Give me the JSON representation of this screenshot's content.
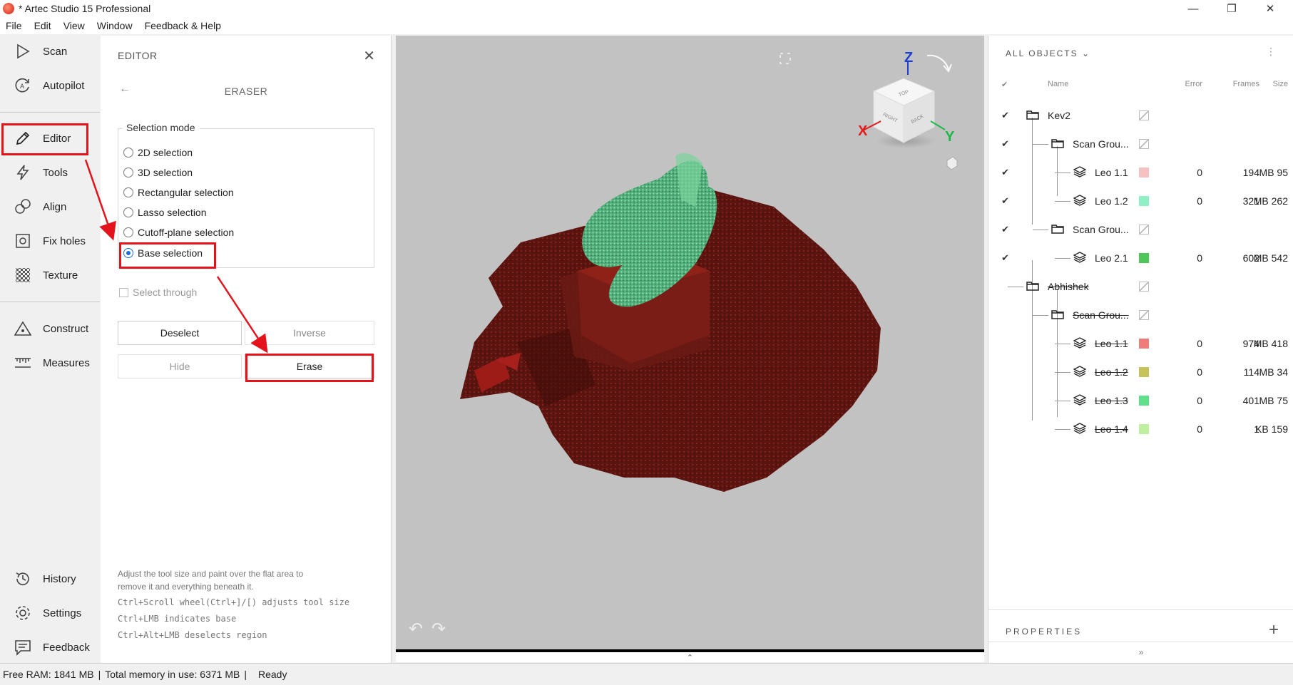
{
  "window": {
    "title": "* Artec Studio 15 Professional",
    "minimize": "—",
    "restore": "❐",
    "close": "✕"
  },
  "menu": [
    "File",
    "Edit",
    "View",
    "Window",
    "Feedback & Help"
  ],
  "nav": {
    "scan": "Scan",
    "autopilot": "Autopilot",
    "editor": "Editor",
    "tools": "Tools",
    "align": "Align",
    "fix_holes": "Fix holes",
    "texture": "Texture",
    "construct": "Construct",
    "measures": "Measures",
    "history": "History",
    "settings": "Settings",
    "feedback": "Feedback"
  },
  "editor": {
    "title": "EDITOR",
    "subtitle": "ERASER",
    "selection_mode_label": "Selection mode",
    "modes": [
      "2D selection",
      "3D selection",
      "Rectangular selection",
      "Lasso selection",
      "Cutoff-plane selection",
      "Base selection"
    ],
    "selected_mode": "Base selection",
    "select_through": "Select through",
    "deselect": "Deselect",
    "inverse": "Inverse",
    "hide": "Hide",
    "erase": "Erase",
    "help": [
      "Adjust the tool size and paint over the flat area to",
      "remove it and everything beneath it.",
      "Ctrl+Scroll wheel(Ctrl+]/[) adjusts tool size",
      "Ctrl+LMB indicates base",
      "Ctrl+Alt+LMB deselects region"
    ]
  },
  "viewport": {
    "axis_x": "X",
    "axis_y": "Y",
    "axis_z": "Z",
    "cube_top": "TOP",
    "cube_right": "RIGHT",
    "cube_back": "BACK",
    "undo": "↶",
    "redo": "↷",
    "expand": "⌃"
  },
  "objects": {
    "header": "ALL OBJECTS",
    "columns": {
      "name": "Name",
      "error": "Error",
      "frames": "Frames",
      "size": "Size"
    },
    "rows": [
      {
        "name": "Kev2",
        "type": "folder",
        "checked": true,
        "error": "",
        "frames": "",
        "size": "",
        "color": "",
        "struck": false
      },
      {
        "name": "Scan Grou...",
        "type": "folder",
        "checked": true,
        "error": "",
        "frames": "",
        "size": "",
        "color": "",
        "struck": false
      },
      {
        "name": "Leo 1.1",
        "type": "scan",
        "checked": true,
        "error": "0",
        "frames": "194",
        "size": "95 MB",
        "color": "#f6c1c1",
        "struck": false
      },
      {
        "name": "Leo 1.2",
        "type": "scan",
        "checked": true,
        "error": "0",
        "frames": "321",
        "size": "262 MB",
        "color": "#8ff0c6",
        "struck": false
      },
      {
        "name": "Scan Grou...",
        "type": "folder",
        "checked": true,
        "error": "",
        "frames": "",
        "size": "",
        "color": "",
        "struck": false
      },
      {
        "name": "Leo 2.1",
        "type": "scan",
        "checked": true,
        "error": "0",
        "frames": "602",
        "size": "542 MB",
        "color": "#4fc65a",
        "struck": false
      },
      {
        "name": "Abhishek",
        "type": "folder",
        "checked": false,
        "error": "",
        "frames": "",
        "size": "",
        "color": "",
        "struck": true
      },
      {
        "name": "Scan Grou...",
        "type": "folder",
        "checked": false,
        "error": "",
        "frames": "",
        "size": "",
        "color": "",
        "struck": true
      },
      {
        "name": "Leo 1.1",
        "type": "scan",
        "checked": false,
        "error": "0",
        "frames": "974",
        "size": "418 MB",
        "color": "#f07b7b",
        "struck": true
      },
      {
        "name": "Leo 1.2",
        "type": "scan",
        "checked": false,
        "error": "0",
        "frames": "114",
        "size": "34 MB",
        "color": "#c8c25a",
        "struck": true
      },
      {
        "name": "Leo 1.3",
        "type": "scan",
        "checked": false,
        "error": "0",
        "frames": "401",
        "size": "75 MB",
        "color": "#5fe08a",
        "struck": true
      },
      {
        "name": "Leo 1.4",
        "type": "scan",
        "checked": false,
        "error": "0",
        "frames": "1",
        "size": "159 KB",
        "color": "#bff0a0",
        "struck": true
      }
    ],
    "properties": "PROPERTIES"
  },
  "status": {
    "free_ram": "Free RAM: 1841 MB",
    "total_memory": "Total memory in use: 6371 MB",
    "state": "Ready"
  },
  "colors": {
    "accent": "#1a6fd6",
    "highlight": "#e3121b"
  }
}
